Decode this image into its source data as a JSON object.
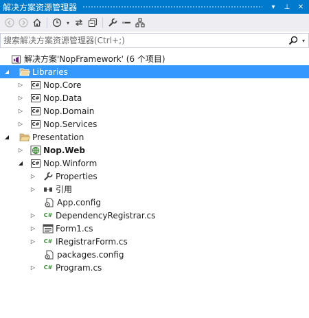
{
  "window": {
    "title": "解决方案资源管理器",
    "pin_glyph": "▾",
    "autohide_glyph": "⊥",
    "close_glyph": "✕"
  },
  "toolbar": {
    "back_glyph": "◀",
    "forward_glyph": "▶",
    "dropdown_glyph": "▾"
  },
  "search": {
    "placeholder": "搜索解决方案资源管理器(Ctrl+;)",
    "dropdown_glyph": "▾"
  },
  "glyphs": {
    "expanded": "◢",
    "collapsed": "▷",
    "cs_badge": "C#",
    "cs_file": "C#"
  },
  "tree": {
    "solution": "解决方案'NopFramework' (6 个项目)",
    "libraries": "Libraries",
    "nop_core": "Nop.Core",
    "nop_data": "Nop.Data",
    "nop_domain": "Nop.Domain",
    "nop_services": "Nop.Services",
    "presentation": "Presentation",
    "nop_web": "Nop.Web",
    "nop_winform": "Nop.Winform",
    "properties": "Properties",
    "references": "引用",
    "app_config": "App.config",
    "dependency_registrar": "DependencyRegistrar.cs",
    "form1": "Form1.cs",
    "iregistrar_form": "IRegistrarForm.cs",
    "packages_config": "packages.config",
    "program": "Program.cs"
  },
  "colors": {
    "title_bar": "#007acc",
    "selected": "#3399ff",
    "folder": "#dcb67a",
    "cs_green": "#388a34"
  }
}
